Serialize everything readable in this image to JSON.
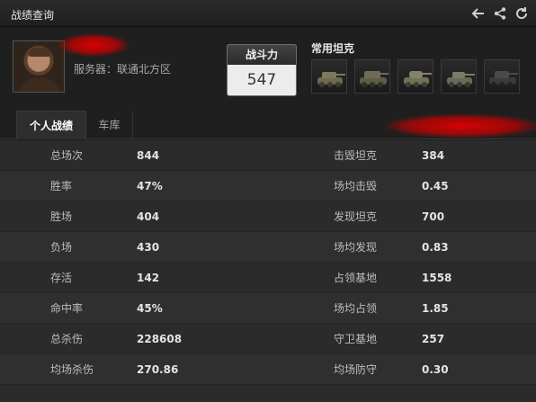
{
  "window": {
    "title": "战绩查询"
  },
  "toolbar": {
    "icons": [
      "back-arrow-icon",
      "share-icon",
      "refresh-icon"
    ]
  },
  "profile": {
    "server_label": "服务器：",
    "server_value": "联通北方区",
    "power_label": "战斗力",
    "power_value": "547",
    "tanks_label": "常用坦克",
    "tanks": [
      "tank-1",
      "tank-2",
      "tank-3",
      "tank-4",
      "tank-5"
    ]
  },
  "tabs": [
    {
      "label": "个人战绩",
      "active": true
    },
    {
      "label": "车库",
      "active": false
    }
  ],
  "stats": {
    "rows": [
      {
        "left_label": "总场次",
        "left_value": "844",
        "right_label": "击毁坦克",
        "right_value": "384"
      },
      {
        "left_label": "胜率",
        "left_value": "47%",
        "right_label": "场均击毁",
        "right_value": "0.45"
      },
      {
        "left_label": "胜场",
        "left_value": "404",
        "right_label": "发现坦克",
        "right_value": "700"
      },
      {
        "left_label": "负场",
        "left_value": "430",
        "right_label": "场均发现",
        "right_value": "0.83"
      },
      {
        "left_label": "存活",
        "left_value": "142",
        "right_label": "占领基地",
        "right_value": "1558"
      },
      {
        "left_label": "命中率",
        "left_value": "45%",
        "right_label": "场均占领",
        "right_value": "1.85"
      },
      {
        "left_label": "总杀伤",
        "left_value": "228608",
        "right_label": "守卫基地",
        "right_value": "257"
      },
      {
        "left_label": "均场杀伤",
        "left_value": "270.86",
        "right_label": "均场防守",
        "right_value": "0.30"
      }
    ]
  }
}
